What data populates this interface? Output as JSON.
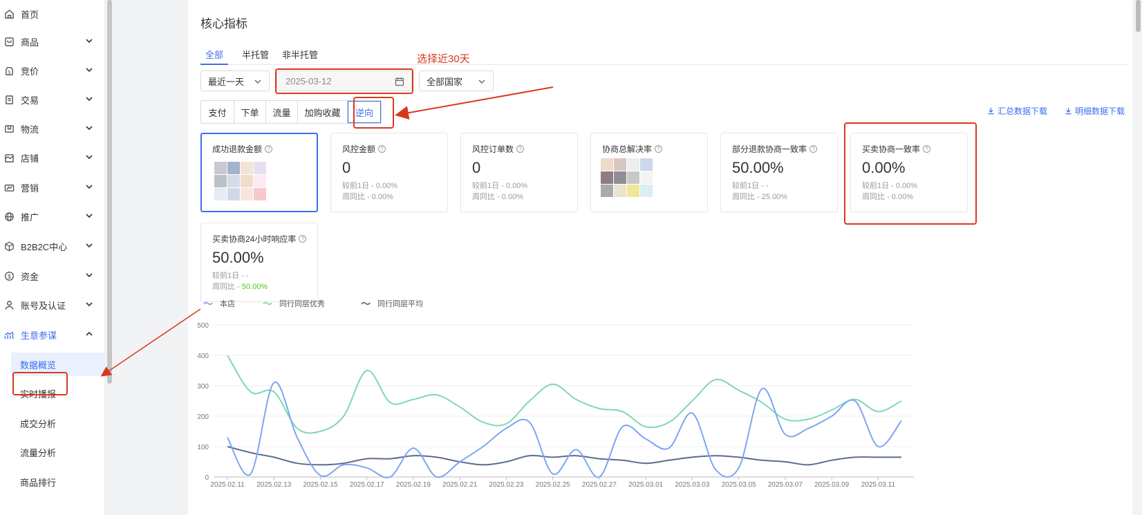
{
  "sidebar": {
    "items": [
      {
        "label": "首页",
        "icon": "home-icon"
      },
      {
        "label": "商品",
        "icon": "product-icon"
      },
      {
        "label": "竞价",
        "icon": "bidding-icon"
      },
      {
        "label": "交易",
        "icon": "trade-icon"
      },
      {
        "label": "物流",
        "icon": "logistics-icon"
      },
      {
        "label": "店铺",
        "icon": "shop-icon"
      },
      {
        "label": "营销",
        "icon": "marketing-icon"
      },
      {
        "label": "推广",
        "icon": "promotion-icon"
      },
      {
        "label": "B2B2C中心",
        "icon": "cube-icon"
      },
      {
        "label": "资金",
        "icon": "funds-icon"
      },
      {
        "label": "账号及认证",
        "icon": "account-icon"
      },
      {
        "label": "生意参谋",
        "icon": "analytics-icon"
      }
    ],
    "subitems": [
      "数据概览",
      "实时播报",
      "成交分析",
      "流量分析",
      "商品排行"
    ]
  },
  "main": {
    "title": "核心指标",
    "tabs": [
      "全部",
      "半托管",
      "非半托管"
    ],
    "period_select": "最近一天",
    "date_value": "2025-03-12",
    "country_select": "全部国家",
    "segments": [
      "支付",
      "下单",
      "流量",
      "加购收藏",
      "逆向"
    ],
    "downloads": [
      "汇总数据下载",
      "明细数据下载"
    ],
    "cards": [
      {
        "label": "成功退款金额",
        "value": "",
        "sub1": "",
        "sub2": "",
        "blurred": true
      },
      {
        "label": "风控金额",
        "value": "0",
        "sub1": "较前1日 - 0.00%",
        "sub2": "周同比 - 0.00%"
      },
      {
        "label": "风控订单数",
        "value": "0",
        "sub1": "较前1日 - 0.00%",
        "sub2": "周同比 - 0.00%"
      },
      {
        "label": "协商总解决率",
        "value": "",
        "sub1": "",
        "sub2": "",
        "blurred": true
      },
      {
        "label": "部分退款协商一致率",
        "value": "50.00%",
        "sub1": "较前1日 - -",
        "sub2": "周同比 - 25.00%"
      },
      {
        "label": "买卖协商一致率",
        "value": "0.00%",
        "sub1": "较前1日 - 0.00%",
        "sub2": "周同比 - 0.00%"
      },
      {
        "label": "买卖协商24小时响应率",
        "value": "50.00%",
        "sub1": "较前1日 - -",
        "sub2_prefix": "周同比 - ",
        "sub2_green": "50.00%"
      }
    ]
  },
  "annotation": {
    "text": "选择近30天",
    "color": "#d9381e"
  },
  "colors": {
    "accent": "#3d6df2",
    "store_line": "#7ea4f4",
    "excellent_line": "#7fd8ae",
    "average_line": "#5b6b8f"
  },
  "chart_data": {
    "type": "line",
    "x": [
      "2025.02.11",
      "2025.02.12",
      "2025.02.13",
      "2025.02.14",
      "2025.02.15",
      "2025.02.16",
      "2025.02.17",
      "2025.02.18",
      "2025.02.19",
      "2025.02.20",
      "2025.02.21",
      "2025.02.22",
      "2025.02.23",
      "2025.02.24",
      "2025.02.25",
      "2025.02.26",
      "2025.02.27",
      "2025.02.28",
      "2025.03.01",
      "2025.03.02",
      "2025.03.03",
      "2025.03.04",
      "2025.03.05",
      "2025.03.06",
      "2025.03.07",
      "2025.03.08",
      "2025.03.09",
      "2025.03.10",
      "2025.03.11",
      "2025.03.12"
    ],
    "x_tick_labels": [
      "2025.02.11",
      "2025.02.13",
      "2025.02.15",
      "2025.02.17",
      "2025.02.19",
      "2025.02.21",
      "2025.02.23",
      "2025.02.25",
      "2025.02.27",
      "2025.03.01",
      "2025.03.03",
      "2025.03.05",
      "2025.03.07",
      "2025.03.09",
      "2025.03.11"
    ],
    "ylim": [
      0,
      500
    ],
    "yticks": [
      0,
      100,
      200,
      300,
      400,
      500
    ],
    "grid": true,
    "legend_position": "top-left",
    "series": [
      {
        "name": "本店",
        "values": [
          130,
          10,
          310,
          130,
          5,
          40,
          30,
          0,
          95,
          0,
          50,
          100,
          160,
          180,
          10,
          90,
          0,
          165,
          125,
          95,
          210,
          25,
          30,
          290,
          140,
          160,
          200,
          250,
          100,
          185
        ]
      },
      {
        "name": "同行同层优秀",
        "values": [
          400,
          280,
          280,
          160,
          150,
          200,
          350,
          245,
          255,
          270,
          230,
          180,
          175,
          250,
          305,
          255,
          225,
          215,
          165,
          180,
          250,
          320,
          285,
          245,
          190,
          190,
          220,
          255,
          215,
          250
        ]
      },
      {
        "name": "同行同层平均",
        "values": [
          100,
          80,
          65,
          45,
          40,
          45,
          60,
          60,
          70,
          65,
          50,
          40,
          50,
          70,
          65,
          70,
          60,
          55,
          45,
          55,
          65,
          70,
          65,
          55,
          50,
          40,
          55,
          65,
          65,
          65
        ]
      }
    ]
  }
}
